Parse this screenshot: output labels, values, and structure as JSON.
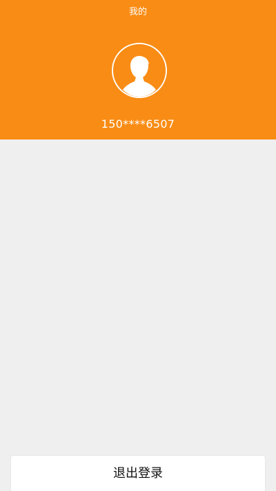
{
  "header": {
    "title": "我的",
    "phone": "150****6507",
    "avatar_icon": "user-avatar-icon"
  },
  "actions": {
    "logout_label": "退出登录"
  },
  "colors": {
    "header_background": "#f98c14",
    "page_background": "#efefef",
    "button_background": "#ffffff"
  }
}
